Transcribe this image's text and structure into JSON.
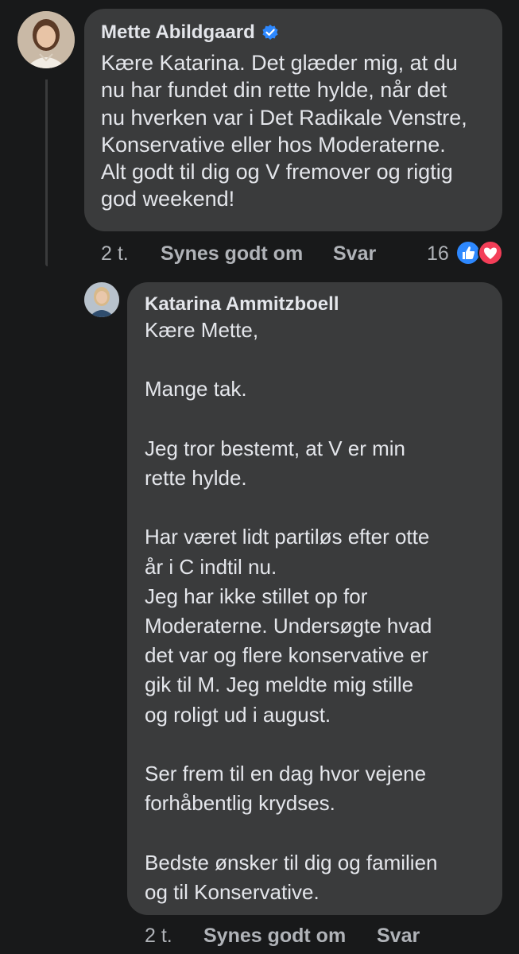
{
  "comment": {
    "author": "Mette Abildgaard",
    "verified_icon": "verified-badge-icon",
    "text": "Kære Katarina. Det glæder mig, at du\nnu har fundet din rette hylde, når det\nnu hverken var i Det Radikale Venstre,\nKonservative eller hos Moderaterne.\nAlt godt til dig og V fremover og rigtig\ngod weekend!",
    "time": "2 t.",
    "like_label": "Synes godt om",
    "reply_label": "Svar",
    "reaction_count": "16",
    "reaction_icons": [
      "like-reaction-icon",
      "love-reaction-icon"
    ],
    "colors": {
      "like": "#2d88ff",
      "love": "#f33e58",
      "verified": "#2d88ff"
    }
  },
  "reply": {
    "author": "Katarina Ammitzboell",
    "text": "Kære Mette,\n\nMange tak.\n\nJeg tror bestemt, at V er min\nrette hylde.\n\nHar været lidt partiløs efter otte\når i C indtil nu.\nJeg har ikke stillet op for\nModeraterne. Undersøgte hvad\ndet var og flere konservative er\ngik til M.  Jeg meldte mig stille\nog roligt ud i august.\n\nSer frem til en dag hvor vejene\nforhåbentlig krydses.\n\nBedste ønsker til dig og familien\nog til Konservative.",
    "time": "2 t.",
    "like_label": "Synes godt om",
    "reply_label": "Svar"
  }
}
